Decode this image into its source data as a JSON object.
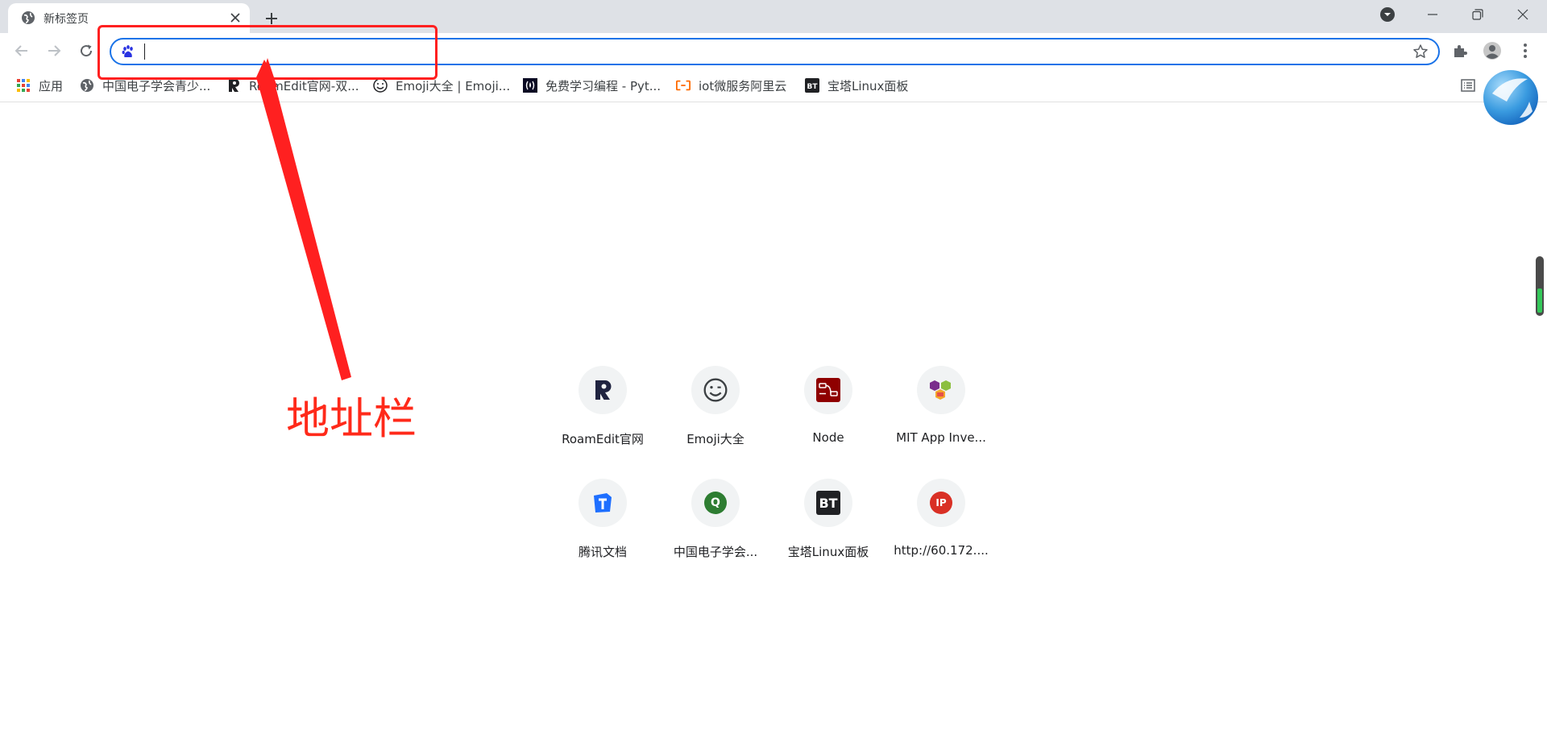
{
  "tab": {
    "title": "新标签页"
  },
  "omnibox": {
    "value": "",
    "placeholder": ""
  },
  "bookmarks": [
    {
      "label": "应用",
      "icon": "apps-grid-icon"
    },
    {
      "label": "中国电子学会青少...",
      "icon": "globe-icon"
    },
    {
      "label": "RoamEdit官网-双...",
      "icon": "roamedit-icon"
    },
    {
      "label": "Emoji大全 | Emoji...",
      "icon": "smiley-icon"
    },
    {
      "label": "免费学习编程 - Pyt...",
      "icon": "freecodecamp-icon"
    },
    {
      "label": "iot微服务阿里云",
      "icon": "aliyun-icon"
    },
    {
      "label": "宝塔Linux面板",
      "icon": "bt-icon"
    }
  ],
  "shortcuts": [
    {
      "label": "RoamEdit官网",
      "icon": "roamedit-icon"
    },
    {
      "label": "Emoji大全",
      "icon": "smiley-icon"
    },
    {
      "label": "Node",
      "icon": "node-red-icon"
    },
    {
      "label": "MIT App Inve...",
      "icon": "mit-app-inventor-icon"
    },
    {
      "label": "腾讯文档",
      "icon": "tencent-docs-icon"
    },
    {
      "label": "中国电子学会...",
      "icon": "letter-q-icon",
      "glyph": "Q"
    },
    {
      "label": "宝塔Linux面板",
      "icon": "bt-icon",
      "glyph": "BT"
    },
    {
      "label": "http://60.172....",
      "icon": "ip-icon",
      "glyph": "IP"
    }
  ],
  "annotation": {
    "text": "地址栏",
    "color": "#ff2020"
  },
  "colors": {
    "accent": "#1a73e8",
    "tabstrip": "#dee1e6"
  }
}
